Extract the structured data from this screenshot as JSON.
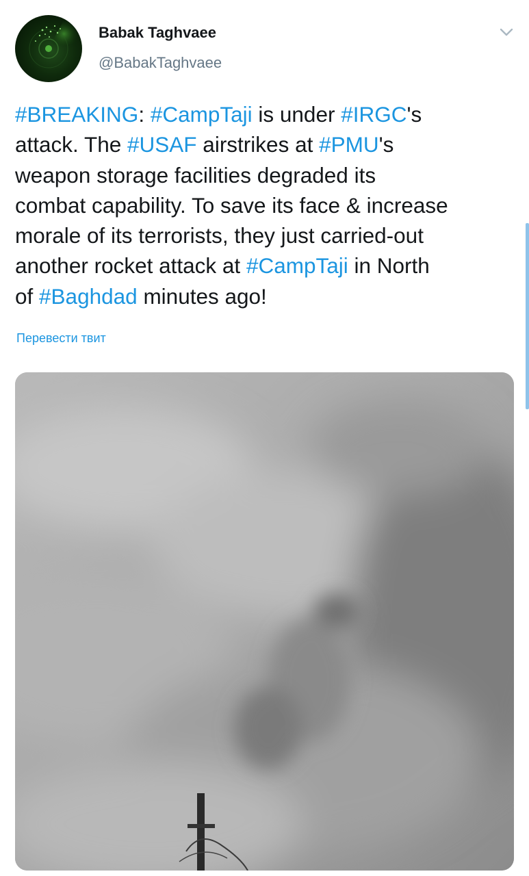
{
  "author": {
    "display_name": "Babak Taghvaee",
    "handle": "@BabakTaghvaee"
  },
  "tweet": {
    "lines": [
      [
        {
          "text": "#BREAKING",
          "hashtag": true
        },
        {
          "text": ": ",
          "hashtag": false
        },
        {
          "text": "#CampTaji",
          "hashtag": true
        },
        {
          "text": " is under ",
          "hashtag": false
        },
        {
          "text": "#IRGC",
          "hashtag": true
        },
        {
          "text": "'s",
          "hashtag": false
        }
      ],
      [
        {
          "text": "attack. The ",
          "hashtag": false
        },
        {
          "text": "#USAF",
          "hashtag": true
        },
        {
          "text": " airstrikes at ",
          "hashtag": false
        },
        {
          "text": "#PMU",
          "hashtag": true
        },
        {
          "text": "'s",
          "hashtag": false
        }
      ],
      [
        {
          "text": "weapon storage facilities degraded its",
          "hashtag": false
        }
      ],
      [
        {
          "text": "combat capability. To save its face & increase",
          "hashtag": false
        }
      ],
      [
        {
          "text": "morale of its terrorists, they just carried-out",
          "hashtag": false
        }
      ],
      [
        {
          "text": "another rocket attack at ",
          "hashtag": false
        },
        {
          "text": "#CampTaji",
          "hashtag": true
        },
        {
          "text": " in North",
          "hashtag": false
        }
      ],
      [
        {
          "text": "of ",
          "hashtag": false
        },
        {
          "text": "#Baghdad",
          "hashtag": true
        },
        {
          "text": " minutes ago!",
          "hashtag": false
        }
      ]
    ],
    "translate_label": "Перевести твит"
  },
  "icons": {
    "avatar": "radar-avatar",
    "menu": "chevron-down-icon"
  },
  "colors": {
    "link": "#1b95e0",
    "text": "#14171a",
    "muted": "#657786",
    "scrollbar": "#8fc3ea"
  }
}
